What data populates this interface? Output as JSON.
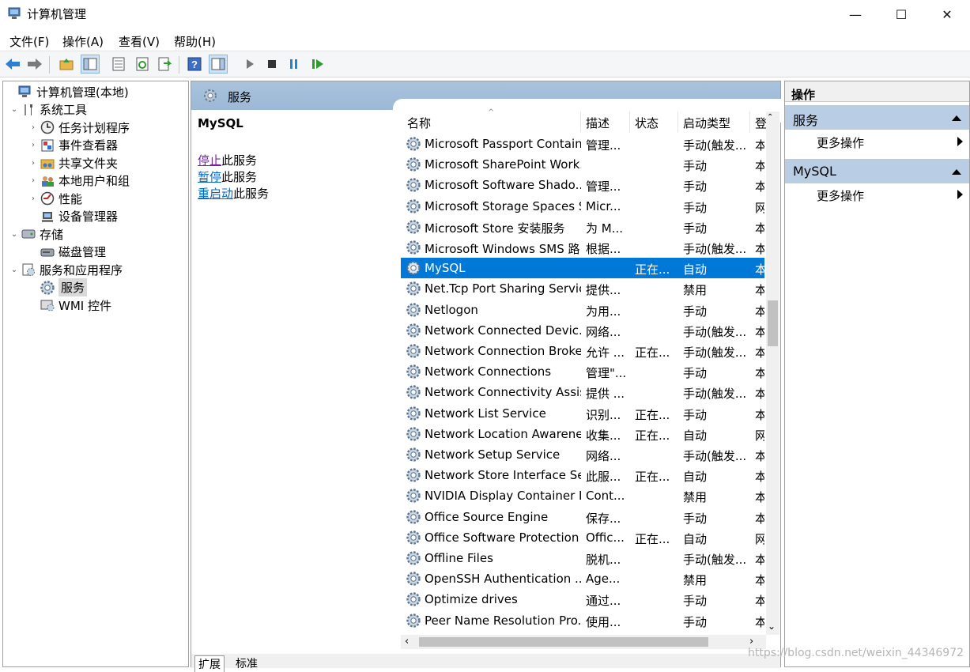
{
  "window": {
    "title": "计算机管理",
    "minimize_glyph": "—",
    "maximize_glyph": "☐",
    "close_glyph": "✕"
  },
  "menu": [
    "文件(F)",
    "操作(A)",
    "查看(V)",
    "帮助(H)"
  ],
  "toolbar": [
    "back-icon",
    "forward-icon",
    "up-folder-icon",
    "show-hide-tree-icon",
    "properties-icon",
    "refresh-icon",
    "export-icon",
    "help-icon",
    "action-pane-icon",
    "start-service-icon",
    "stop-service-icon",
    "pause-service-icon",
    "restart-service-icon"
  ],
  "tree": [
    {
      "label": "计算机管理(本地)",
      "level": 0,
      "twisty": "",
      "icon": "computer-management-icon"
    },
    {
      "label": "系统工具",
      "level": 1,
      "twisty": "⌄",
      "icon": "tools-icon"
    },
    {
      "label": "任务计划程序",
      "level": 2,
      "twisty": "›",
      "icon": "clock-icon"
    },
    {
      "label": "事件查看器",
      "level": 2,
      "twisty": "›",
      "icon": "event-viewer-icon"
    },
    {
      "label": "共享文件夹",
      "level": 2,
      "twisty": "›",
      "icon": "shared-folder-icon"
    },
    {
      "label": "本地用户和组",
      "level": 2,
      "twisty": "›",
      "icon": "users-icon"
    },
    {
      "label": "性能",
      "level": 2,
      "twisty": "›",
      "icon": "performance-icon"
    },
    {
      "label": "设备管理器",
      "level": 2,
      "twisty": "",
      "icon": "device-manager-icon"
    },
    {
      "label": "存储",
      "level": 1,
      "twisty": "⌄",
      "icon": "storage-icon"
    },
    {
      "label": "磁盘管理",
      "level": 2,
      "twisty": "",
      "icon": "disk-icon"
    },
    {
      "label": "服务和应用程序",
      "level": 1,
      "twisty": "⌄",
      "icon": "services-apps-icon"
    },
    {
      "label": "服务",
      "level": 2,
      "twisty": "",
      "icon": "gear-icon",
      "selected": true
    },
    {
      "label": "WMI 控件",
      "level": 2,
      "twisty": "",
      "icon": "wmi-icon"
    }
  ],
  "center": {
    "header": "服务",
    "selected_name": "MySQL",
    "actions": [
      {
        "link": "停止",
        "rest": "此服务",
        "link_color": "#7a1fa2"
      },
      {
        "link": "暂停",
        "rest": "此服务",
        "link_color": "#0066cc"
      },
      {
        "link": "重启动",
        "rest": "此服务",
        "link_color": "#0066cc"
      }
    ],
    "columns": [
      "名称",
      "描述",
      "状态",
      "启动类型",
      "登"
    ],
    "sort_glyph": "^",
    "rows": [
      [
        "Microsoft Passport Container",
        "管理...",
        "",
        "手动(触发...",
        "本"
      ],
      [
        "Microsoft SharePoint Work...",
        "",
        "",
        "手动",
        "本"
      ],
      [
        "Microsoft Software Shado...",
        "管理...",
        "",
        "手动",
        "本"
      ],
      [
        "Microsoft Storage Spaces S...",
        "Micr...",
        "",
        "手动",
        "网"
      ],
      [
        "Microsoft Store 安装服务",
        "为 M...",
        "",
        "手动",
        "本"
      ],
      [
        "Microsoft Windows SMS 路...",
        "根据...",
        "",
        "手动(触发...",
        "本"
      ],
      [
        "MySQL",
        "",
        "正在...",
        "自动",
        "本"
      ],
      [
        "Net.Tcp Port Sharing Service",
        "提供...",
        "",
        "禁用",
        "本"
      ],
      [
        "Netlogon",
        "为用...",
        "",
        "手动",
        "本"
      ],
      [
        "Network Connected Devic...",
        "网络...",
        "",
        "手动(触发...",
        "本"
      ],
      [
        "Network Connection Broker",
        "允许 ...",
        "正在...",
        "手动(触发...",
        "本"
      ],
      [
        "Network Connections",
        "管理\"...",
        "",
        "手动",
        "本"
      ],
      [
        "Network Connectivity Assis...",
        "提供 ...",
        "",
        "手动(触发...",
        "本"
      ],
      [
        "Network List Service",
        "识别...",
        "正在...",
        "手动",
        "本"
      ],
      [
        "Network Location Awarene...",
        "收集...",
        "正在...",
        "自动",
        "网"
      ],
      [
        "Network Setup Service",
        "网络...",
        "",
        "手动(触发...",
        "本"
      ],
      [
        "Network Store Interface Se...",
        "此服...",
        "正在...",
        "自动",
        "本"
      ],
      [
        "NVIDIA Display Container LS",
        "Cont...",
        "",
        "禁用",
        "本"
      ],
      [
        "Office  Source Engine",
        "保存...",
        "",
        "手动",
        "本"
      ],
      [
        "Office Software Protection ...",
        "Offic...",
        "正在...",
        "自动",
        "网"
      ],
      [
        "Offline Files",
        "脱机...",
        "",
        "手动(触发...",
        "本"
      ],
      [
        "OpenSSH Authentication ...",
        "Age...",
        "",
        "禁用",
        "本"
      ],
      [
        "Optimize drives",
        "通过...",
        "",
        "手动",
        "本"
      ],
      [
        "Peer Name Resolution Pro...",
        "使用...",
        "",
        "手动",
        "本"
      ]
    ],
    "selected_row": 6,
    "tabs": [
      "扩展",
      "标准"
    ]
  },
  "actions_pane": {
    "title": "操作",
    "sections": [
      {
        "label": "服务",
        "more": "更多操作"
      },
      {
        "label": "MySQL",
        "more": "更多操作"
      }
    ]
  },
  "watermark": "https://blog.csdn.net/weixin_44346972",
  "colors": {
    "selection": "#0078d7",
    "header": "#9bb8d6",
    "section": "#b9cde5"
  }
}
